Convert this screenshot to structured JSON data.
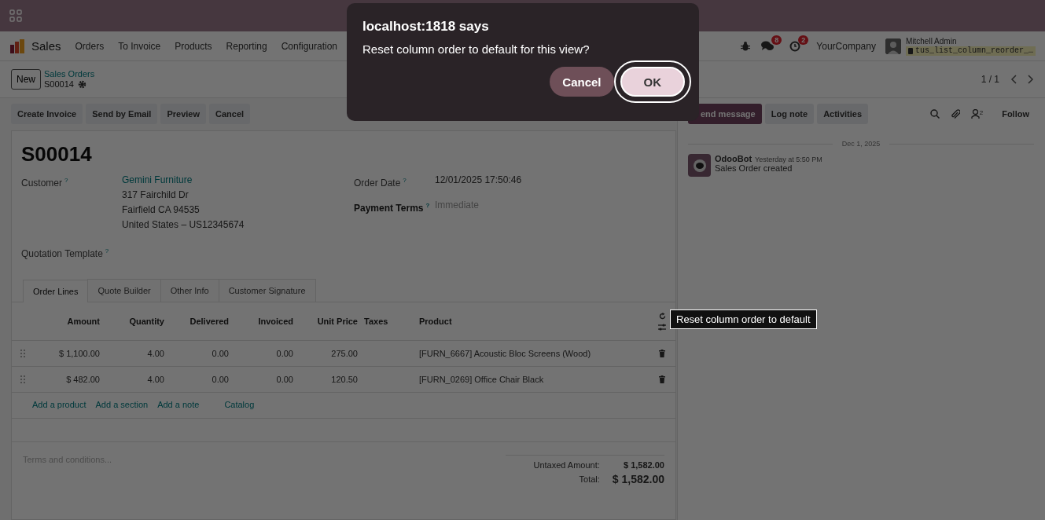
{
  "navbar": {
    "app_name": "Sales",
    "menu": [
      "Orders",
      "To Invoice",
      "Products",
      "Reporting",
      "Configuration"
    ],
    "messages_count": "8",
    "activities_count": "2",
    "company": "YourCompany",
    "user": "Mitchell Admin",
    "database": "tus_list_column_reorder_…"
  },
  "control_panel": {
    "new_button": "New",
    "breadcrumb": "Sales Orders",
    "record": "S00014",
    "pager": "1 / 1"
  },
  "action_buttons": [
    "Create Invoice",
    "Send by Email",
    "Preview",
    "Cancel"
  ],
  "form": {
    "title": "S00014",
    "customer": {
      "label": "Customer",
      "help": "?",
      "name": "Gemini Furniture",
      "address": [
        "317 Fairchild Dr",
        "Fairfield CA 94535",
        "United States – US12345674"
      ]
    },
    "order_date": {
      "label": "Order Date",
      "help": "?",
      "value": "12/01/2025 17:50:46"
    },
    "payment_terms": {
      "label": "Payment Terms",
      "help": "?",
      "value": "Immediate"
    },
    "quotation_template": {
      "label": "Quotation Template",
      "help": "?"
    },
    "tabs": [
      {
        "label": "Order Lines",
        "selected": true
      },
      {
        "label": "Quote Builder",
        "selected": false
      },
      {
        "label": "Other Info",
        "selected": false
      },
      {
        "label": "Customer Signature",
        "selected": false
      }
    ],
    "table": {
      "columns": [
        "Amount",
        "Quantity",
        "Delivered",
        "Invoiced",
        "Unit Price",
        "Taxes",
        "Product"
      ],
      "rows": [
        [
          "$ 1,100.00",
          "4.00",
          "0.00",
          "0.00",
          "275.00",
          "",
          "[FURN_6667] Acoustic Bloc Screens (Wood)"
        ],
        [
          "$ 482.00",
          "4.00",
          "0.00",
          "0.00",
          "120.50",
          "",
          "[FURN_0269] Office Chair Black"
        ]
      ],
      "add_links": [
        "Add a product",
        "Add a section",
        "Add a note",
        "Catalog"
      ]
    },
    "notes_placeholder": "Terms and conditions...",
    "totals": [
      {
        "label": "Untaxed Amount:",
        "value": "$ 1,582.00",
        "kind": "subtotal"
      },
      {
        "label": "Total:",
        "value": "$ 1,582.00",
        "kind": "total"
      }
    ]
  },
  "tooltip": "Reset column order to default",
  "chatter": {
    "buttons": [
      "end message",
      "Log note",
      "Activities"
    ],
    "followers_count": "2",
    "follow": "Follow",
    "date": "Dec 1, 2025",
    "messages": [
      {
        "author": "OdooBot",
        "time": "Yesterday at 5:50 PM",
        "body": "Sales Order created"
      }
    ]
  },
  "dialog": {
    "title": "localhost:1818 says",
    "message": "Reset column order to default for this view?",
    "buttons": [
      {
        "label": "Cancel",
        "kind": "secondary",
        "focused": false
      },
      {
        "label": "OK",
        "kind": "primary",
        "focused": true
      }
    ]
  }
}
